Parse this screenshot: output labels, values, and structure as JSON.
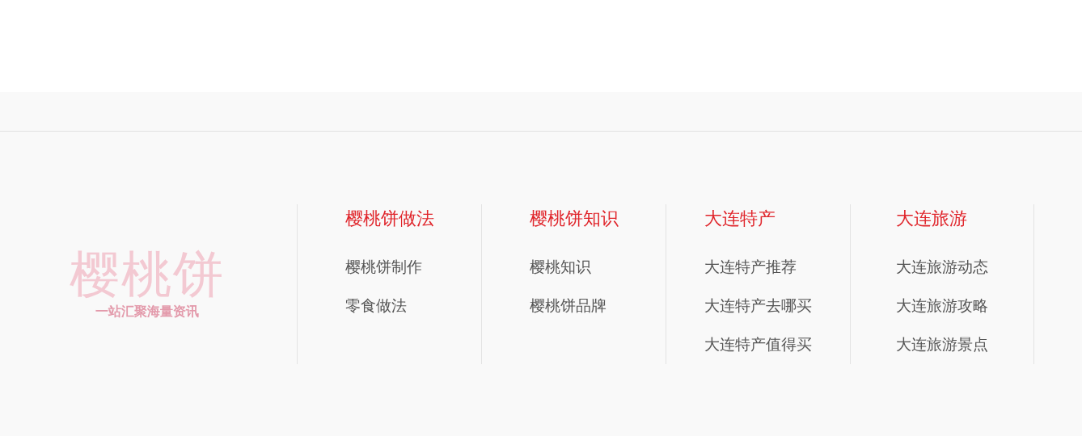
{
  "logo": {
    "title": "樱桃饼",
    "slogan": "一站汇聚海量资讯"
  },
  "columns": [
    {
      "heading": "樱桃饼做法",
      "links": [
        "樱桃饼制作",
        "零食做法"
      ]
    },
    {
      "heading": "樱桃饼知识",
      "links": [
        "樱桃知识",
        "樱桃饼品牌"
      ]
    },
    {
      "heading": "大连特产",
      "links": [
        "大连特产推荐",
        "大连特产去哪买",
        "大连特产值得买"
      ]
    },
    {
      "heading": "大连旅游",
      "links": [
        "大连旅游动态",
        "大连旅游攻略",
        "大连旅游景点"
      ]
    }
  ]
}
